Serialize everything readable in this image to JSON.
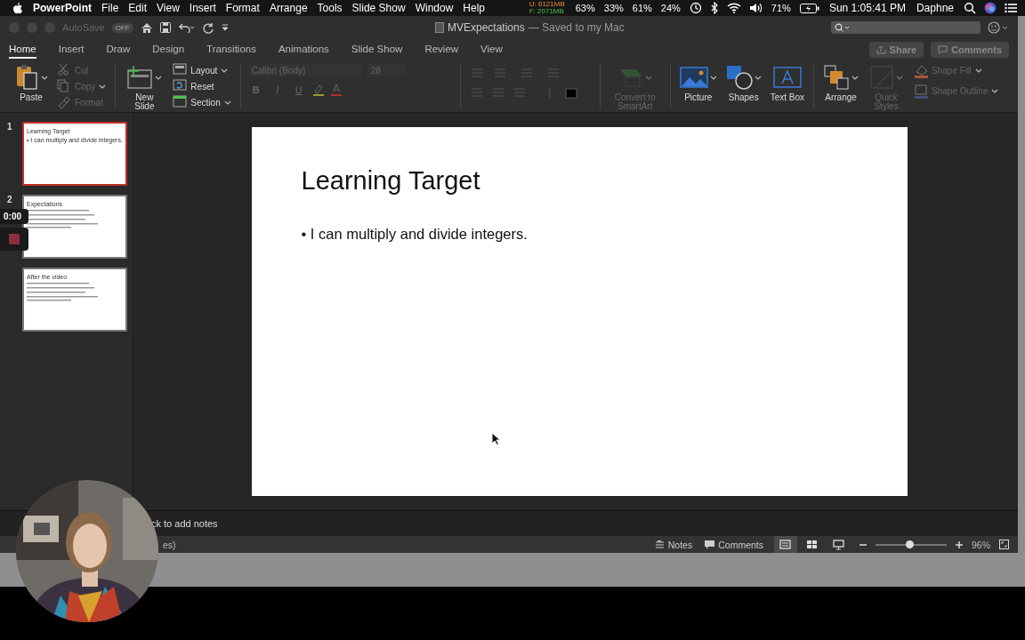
{
  "menu_bar": {
    "app": "PowerPoint",
    "menus": [
      "File",
      "Edit",
      "View",
      "Insert",
      "Format",
      "Arrange",
      "Tools",
      "Slide Show",
      "Window",
      "Help"
    ],
    "memory_used": "U: 6121MB",
    "memory_free": "F: 2071MB",
    "stats": [
      "63%",
      "33%",
      "61%",
      "24%"
    ],
    "battery": "71%",
    "clock": "Sun 1:05:41 PM",
    "user": "Daphne"
  },
  "window": {
    "autosave": "AutoSave",
    "autosave_toggle": "OFF",
    "title": "MVExpectations",
    "subtitle": "— Saved to my Mac"
  },
  "tabs": [
    {
      "label": "Home",
      "selected": true
    },
    {
      "label": "Insert",
      "selected": false
    },
    {
      "label": "Draw",
      "selected": false
    },
    {
      "label": "Design",
      "selected": false
    },
    {
      "label": "Transitions",
      "selected": false
    },
    {
      "label": "Animations",
      "selected": false
    },
    {
      "label": "Slide Show",
      "selected": false
    },
    {
      "label": "Review",
      "selected": false
    },
    {
      "label": "View",
      "selected": false
    }
  ],
  "actions": [
    "Share",
    "Comments"
  ],
  "ribbon": {
    "paste": {
      "label": "Paste",
      "disabled": false
    },
    "cut": {
      "label": "Cut",
      "disabled": true
    },
    "copy": {
      "label": "Copy",
      "disabled": true
    },
    "format": {
      "label": "Format",
      "disabled": true
    },
    "new_slide": {
      "label": "New Slide",
      "disabled": false
    },
    "layout": {
      "label": "Layout",
      "disabled": false
    },
    "reset": {
      "label": "Reset",
      "disabled": false
    },
    "section": {
      "label": "Section",
      "disabled": false
    },
    "font": {
      "value": "Calibri (Body)",
      "disabled": true
    },
    "size": {
      "value": "28",
      "disabled": true
    },
    "styles": [
      {
        "label": "B",
        "disabled": true
      },
      {
        "label": "I",
        "disabled": true
      },
      {
        "label": "U",
        "disabled": true
      }
    ],
    "smartart": {
      "label": "Convert to SmartArt",
      "disabled": true
    },
    "picture": {
      "label": "Picture",
      "disabled": false
    },
    "shapes": {
      "label": "Shapes",
      "disabled": false
    },
    "text_box": {
      "label": "Text Box",
      "disabled": false
    },
    "arrange": {
      "label": "Arrange",
      "disabled": false
    },
    "quick_styles": {
      "label": "Quick Styles",
      "disabled": true
    },
    "shape_fill": {
      "label": "Shape Fill",
      "disabled": true
    },
    "shape_outline": {
      "label": "Shape Outline",
      "disabled": true
    }
  },
  "thumbnails": [
    {
      "number": "1",
      "title": "Learning Target",
      "selected": true,
      "bullets": [
        "• I can multiply and divide integers."
      ]
    },
    {
      "number": "2",
      "title": "Expectations",
      "selected": false
    },
    {
      "title": "After the video",
      "selected": false
    }
  ],
  "slide": {
    "title": "Learning Target",
    "bullets": [
      "• I can multiply and divide integers."
    ]
  },
  "notes": {
    "placeholder": "ck to add notes"
  },
  "status_bar": {
    "text": "es)",
    "notes": "Notes",
    "comments": "Comments",
    "views": [
      {
        "selected": true
      },
      {
        "selected": false
      },
      {
        "selected": false
      }
    ],
    "zoom": {
      "level": 0.48,
      "reading": "96%"
    }
  },
  "recorder": {
    "time": "0:00"
  },
  "webcam": {
    "kind": "picture"
  }
}
